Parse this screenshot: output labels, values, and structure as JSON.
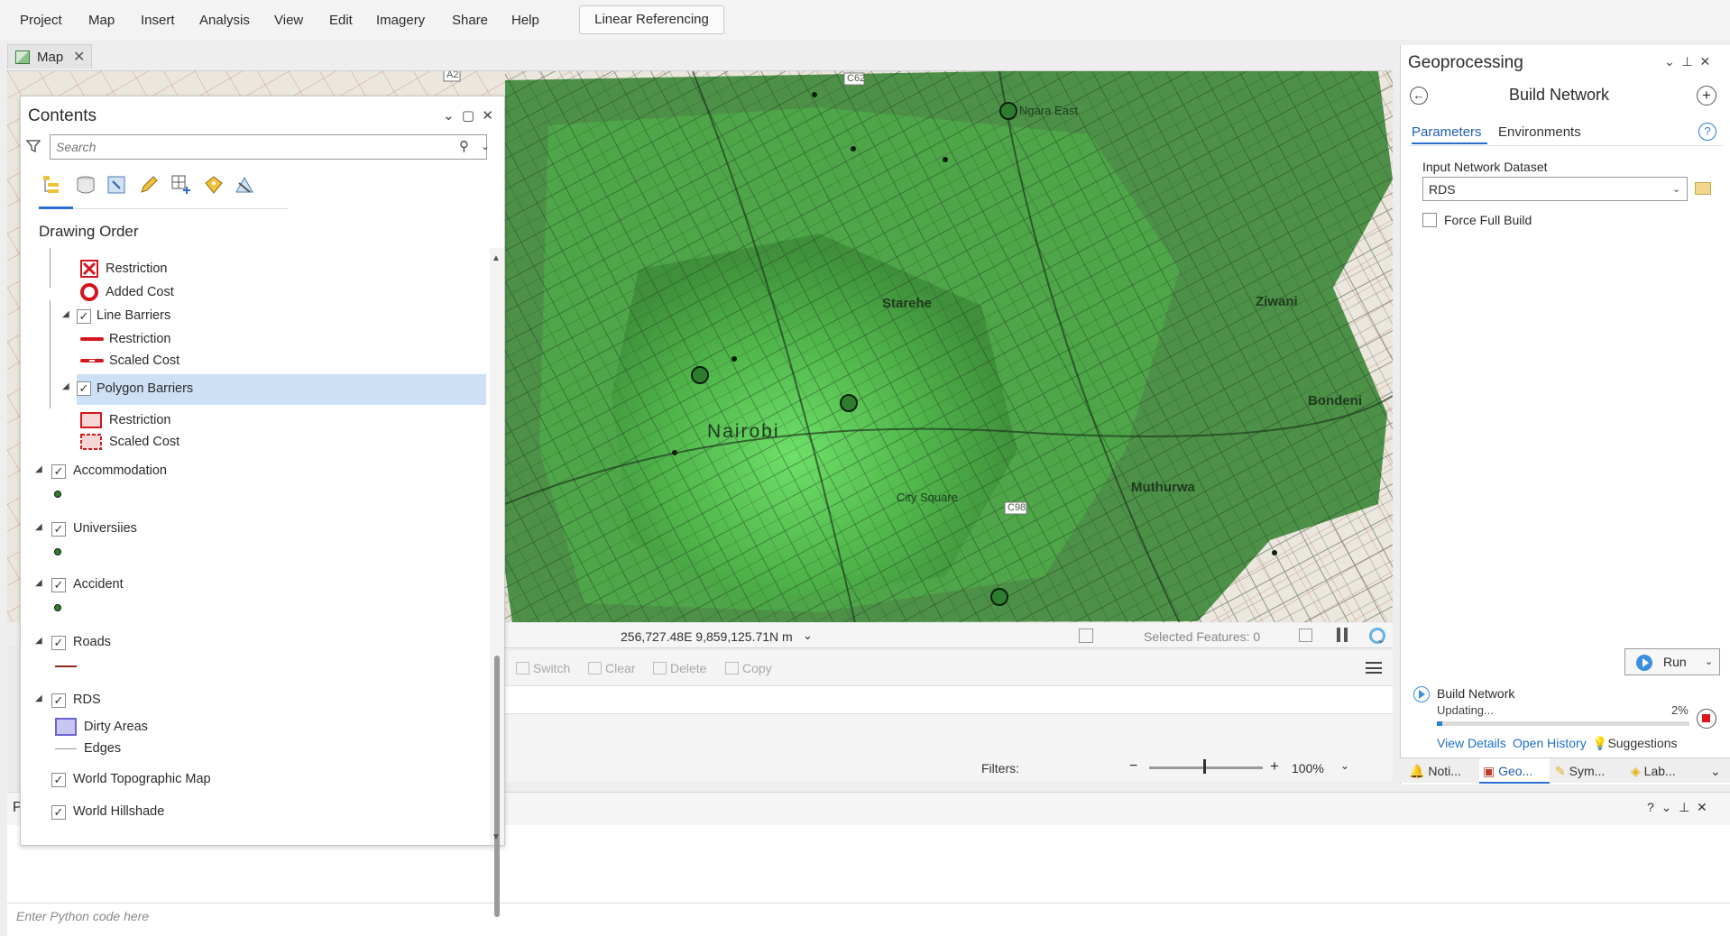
{
  "menu": {
    "items": [
      "Project",
      "Map",
      "Insert",
      "Analysis",
      "View",
      "Edit",
      "Imagery",
      "Share",
      "Help"
    ],
    "contextual_tab": "Linear Referencing"
  },
  "map_tab": {
    "label": "Map"
  },
  "map": {
    "place_labels": {
      "nairobi": "Nairobi",
      "starehe": "Starehe",
      "ziwani": "Ziwani",
      "bondeni": "Bondeni",
      "muthurwa": "Muthurwa",
      "city_square": "City Square",
      "ngara_east": "Ngara East"
    },
    "road_badges": [
      "A2",
      "C62",
      "C98"
    ],
    "colors": {
      "heavy_green": "#3c8f3a",
      "light_green": "#6fe36a",
      "road": "#8a2a1e",
      "background": "#ece7de"
    }
  },
  "coord_bar": {
    "coordinates": "256,727.48E 9,859,125.71N m",
    "selected_features": "Selected Features: 0"
  },
  "attribute_toolbar": {
    "switch": "Switch",
    "clear": "Clear",
    "delete": "Delete",
    "copy": "Copy",
    "filters": "Filters:",
    "zoom": "100%"
  },
  "python": {
    "title": "P",
    "placeholder": "Enter Python code here"
  },
  "contents": {
    "title": "Contents",
    "search_placeholder": "Search",
    "heading": "Drawing Order",
    "items": {
      "restriction_point": "Restriction",
      "added_cost": "Added Cost",
      "line_barriers": "Line Barriers",
      "line_restriction": "Restriction",
      "line_scaled_cost": "Scaled Cost",
      "polygon_barriers": "Polygon Barriers",
      "polygon_restriction": "Restriction",
      "polygon_scaled_cost": "Scaled Cost",
      "accommodation": "Accommodation",
      "universities": "Universiies",
      "accident": "Accident",
      "roads": "Roads",
      "rds": "RDS",
      "dirty_areas": "Dirty Areas",
      "edges": "Edges",
      "world_topographic": "World Topographic Map",
      "world_hillshade": "World Hillshade"
    }
  },
  "geoprocessing": {
    "title": "Geoprocessing",
    "tool": "Build Network",
    "tabs": {
      "parameters": "Parameters",
      "environments": "Environments"
    },
    "input_label": "Input Network Dataset",
    "input_value": "RDS",
    "force_full_build": "Force Full Build",
    "run": "Run",
    "status_tool": "Build Network",
    "status_text": "Updating...",
    "progress_label": "2%",
    "progress": 0.02,
    "view_details": "View Details",
    "open_history": "Open History",
    "suggestions": "Suggestions"
  },
  "dock_tabs": {
    "notifications": "Noti...",
    "geoprocessing": "Geo...",
    "symbology": "Sym...",
    "labeling": "Lab..."
  }
}
